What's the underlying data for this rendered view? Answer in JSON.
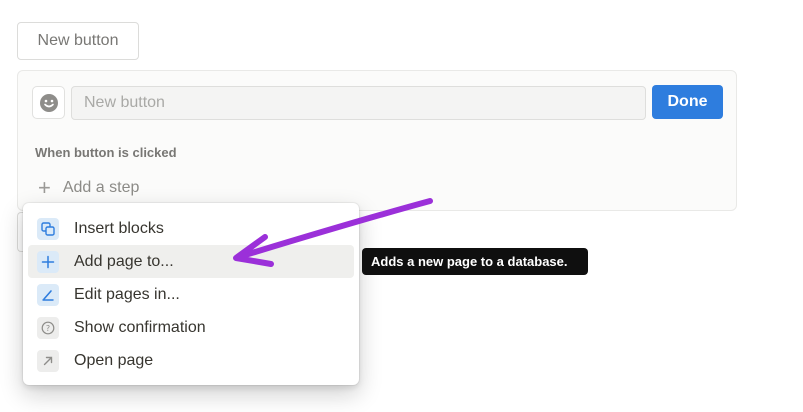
{
  "header": {
    "new_button_label": "New button"
  },
  "editor": {
    "name_placeholder": "New button",
    "name_value": "",
    "done_label": "Done",
    "when_label": "When button is clicked",
    "add_step_label": "Add a step"
  },
  "menu": {
    "items": [
      {
        "label": "Insert blocks",
        "icon": "insert-blocks-icon"
      },
      {
        "label": "Add page to...",
        "icon": "plus-icon"
      },
      {
        "label": "Edit pages in...",
        "icon": "edit-pages-icon"
      },
      {
        "label": "Show confirmation",
        "icon": "question-circle-icon"
      },
      {
        "label": "Open page",
        "icon": "open-page-arrow-icon"
      }
    ],
    "active_index": 1
  },
  "tooltip": {
    "text": "Adds a new page to a database."
  },
  "colors": {
    "accent": "#2e7dde",
    "annotation_arrow": "#9b30d9",
    "tooltip_bg": "#0f0f0f",
    "icon_blue_bg": "#dbeaf8"
  }
}
